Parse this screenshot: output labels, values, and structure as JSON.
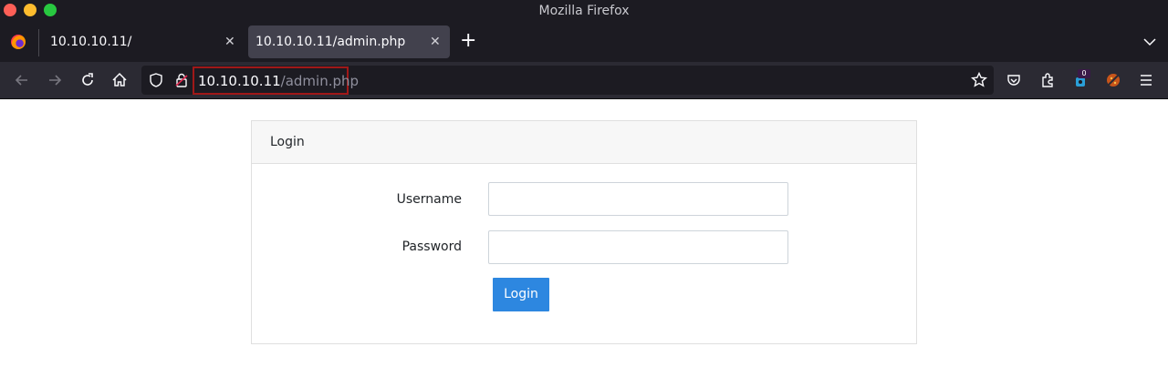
{
  "window": {
    "title": "Mozilla Firefox"
  },
  "tabs": [
    {
      "label": "10.10.10.11/",
      "active": false
    },
    {
      "label": "10.10.10.11/admin.php",
      "active": true
    }
  ],
  "addressbar": {
    "host": "10.10.10.11",
    "path": "/admin.php"
  },
  "toolbar": {
    "extension_badge": "0"
  },
  "icons": {
    "back": "arrow-left-icon",
    "forward": "arrow-right-icon",
    "reload": "reload-icon",
    "home": "home-icon",
    "shield": "shield-icon",
    "lock": "lock-icon",
    "bookmark": "star-icon",
    "pocket": "pocket-icon",
    "extensions": "puzzle-icon",
    "menu": "hamburger-icon"
  },
  "login": {
    "header": "Login",
    "username_label": "Username",
    "password_label": "Password",
    "username_value": "",
    "password_value": "",
    "submit_label": "Login"
  },
  "colors": {
    "accent": "#2d87e0",
    "chrome": "#1c1b22",
    "highlight": "#a01818"
  }
}
